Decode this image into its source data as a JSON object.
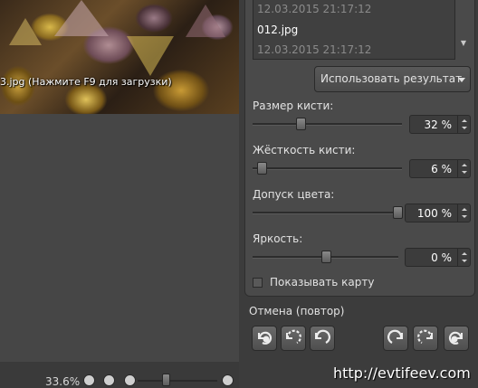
{
  "canvas": {
    "caption": "3.jpg (Нажмите F9 для загрузки)"
  },
  "files": {
    "items": [
      {
        "name": "12.03.2015 21:17:12",
        "kind": "date"
      },
      {
        "name": "012.jpg",
        "kind": "file"
      },
      {
        "name": "12.03.2015 21:17:12",
        "kind": "date"
      }
    ]
  },
  "use_result": {
    "label": "Использовать результат"
  },
  "params": {
    "brush_size": {
      "label": "Размер кисти:",
      "value_text": "32 %",
      "value": 32
    },
    "brush_hardness": {
      "label": "Жёсткость кисти:",
      "value_text": "6 %",
      "value": 6
    },
    "color_tolerance": {
      "label": "Допуск цвета:",
      "value_text": "100 %",
      "value": 100
    },
    "brightness": {
      "label": "Яркость:",
      "value_text": "0 %",
      "value": 0
    }
  },
  "show_map": {
    "label": "Показывать карту",
    "checked": false
  },
  "history": {
    "label": "Отмена (повтор)",
    "buttons": [
      "undo-all-icon",
      "undo-step-icon",
      "undo-icon",
      "redo-icon",
      "redo-step-icon",
      "redo-all-icon"
    ]
  },
  "status": {
    "zoom": "33.6%",
    "icons": [
      "fit-screen-icon",
      "actual-size-icon",
      "zoom-out-icon",
      "zoom-in-icon"
    ],
    "zoom_level": 0.35
  },
  "watermark": "http://evtifeev.com",
  "colors": {
    "panel": "#4a4a4a",
    "background": "#3c3c3c",
    "text": "#e2e2e2"
  }
}
